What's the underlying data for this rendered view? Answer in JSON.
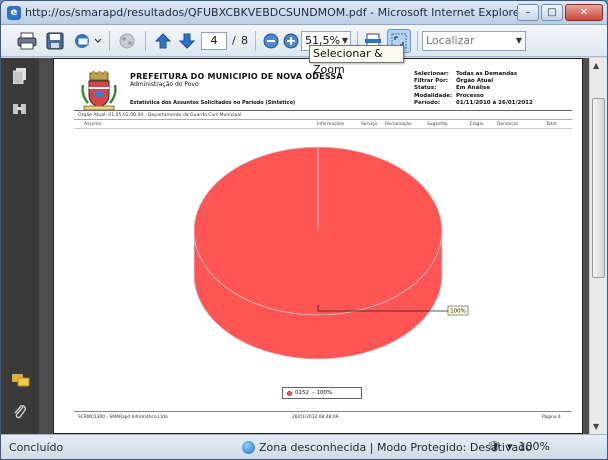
{
  "window": {
    "title": "http://os/smarapd/resultados/QFUBXCBKVEBDCSUNDMOM.pdf - Microsoft Internet Explorer fornecido por SMARapd",
    "icon": "e",
    "min_glyph": "–",
    "max_glyph": "□",
    "close_glyph": "✕"
  },
  "toolbar": {
    "page_current": "4",
    "page_separator": "/",
    "page_total": "8",
    "zoom_value": "51,5%",
    "find_placeholder": "Localizar",
    "tooltip": "Selecionar & Zoom"
  },
  "page": {
    "org_name": "PREFEITURA DO MUNICIPIO DE NOVA ODESSA",
    "org_sub": "Administração do Povo",
    "report_title": "Estatística dos Assuntos Solicitados no Período (Sintético)",
    "filters": [
      {
        "key": "Selecionar:",
        "value": "Todas as Demandas"
      },
      {
        "key": "Filtrar Por:",
        "value": "Órgão Atual"
      },
      {
        "key": "Status:",
        "value": "Em Análise"
      },
      {
        "key": "Modalidade:",
        "value": "Processo"
      },
      {
        "key": "Período:",
        "value": "01/11/2010 à 26/01/2012"
      }
    ],
    "orgao": "Órgão Atual:  01.05.02.00.00 - Departamento da Guarda Civil Municipal",
    "columns": [
      "Assunto",
      "Informações",
      "Serviço",
      "Reclamação",
      "Sugestão",
      "Elogio",
      "Denúncia",
      "Total"
    ],
    "footer_left": "SCRW01300 - SMARapd Informática Ltda",
    "footer_mid": "26/01/2012 08:48:09",
    "footer_right": "Página 4"
  },
  "chart_data": {
    "type": "pie",
    "slices": [
      {
        "label": "0152",
        "value": 100
      }
    ],
    "data_label": "100%",
    "legend": [
      {
        "label": "0152",
        "value_text": "– 100%"
      }
    ],
    "legend_position": "bottom",
    "colors": {
      "slice": "#ff5555"
    }
  },
  "status": {
    "left": "Concluído",
    "zone": "Zona desconhecida | Modo Protegido: Desativado",
    "zoom_label": "100%"
  },
  "colors": {
    "accent": "#2d74c9",
    "pie": "#ff5555"
  }
}
